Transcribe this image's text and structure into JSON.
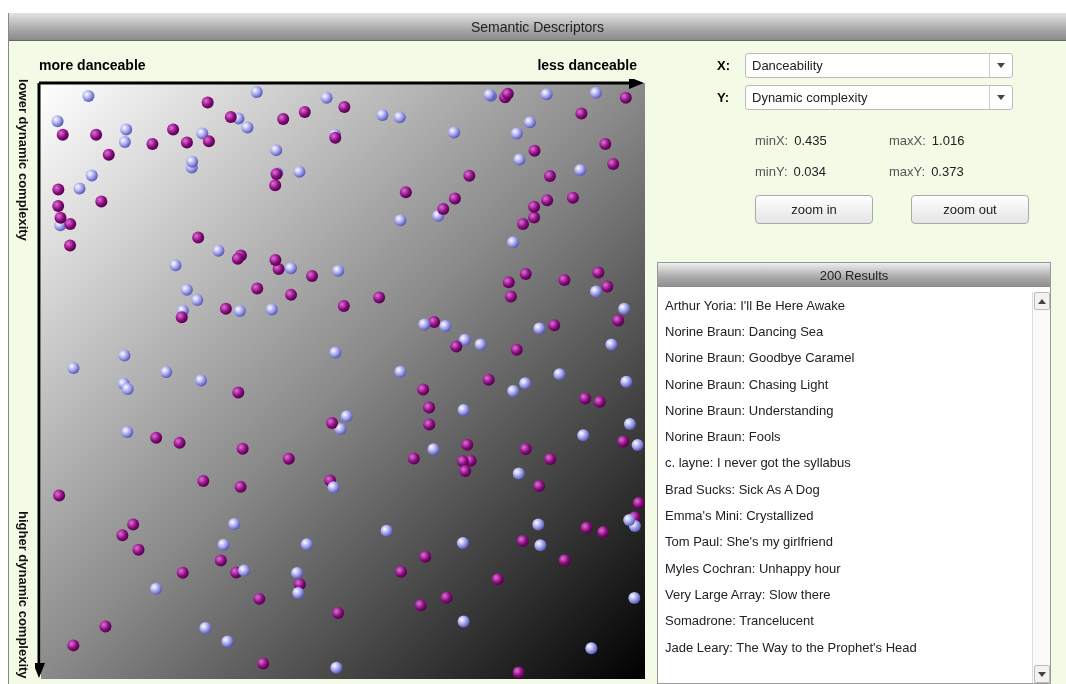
{
  "window": {
    "title": "Semantic Descriptors"
  },
  "plot": {
    "x_axis": {
      "start_label": "more danceable",
      "end_label": "less danceable"
    },
    "y_axis": {
      "start_label": "lower dynamic complexity",
      "end_label": "higher dynamic complexity"
    }
  },
  "controls": {
    "axes": [
      {
        "label": "X:",
        "value": "Danceability"
      },
      {
        "label": "Y:",
        "value": "Dynamic complexity"
      }
    ],
    "ranges": [
      {
        "label": "minX:",
        "value": "0.435"
      },
      {
        "label": "maxX:",
        "value": "1.016"
      },
      {
        "label": "minY:",
        "value": "0.034"
      },
      {
        "label": "maxY:",
        "value": "0.373"
      }
    ],
    "buttons": [
      "zoom in",
      "zoom out"
    ]
  },
  "results": {
    "header": "200 Results",
    "items": [
      "Arthur Yoria: I'll Be Here Awake",
      "Norine Braun: Dancing Sea",
      "Norine Braun: Goodbye Caramel",
      "Norine Braun: Chasing Light",
      "Norine Braun: Understanding",
      "Norine Braun: Fools",
      "c. layne: I never got the syllabus",
      "Brad Sucks: Sick As A Dog",
      "Emma's Mini: Crystallized",
      "Tom Paul: She's my girlfriend",
      "Myles Cochran: Unhappy hour",
      "Very Large Array: Slow there",
      "Somadrone: Trancelucent",
      "Jade Leary: The Way to the Prophet's Head"
    ]
  }
}
